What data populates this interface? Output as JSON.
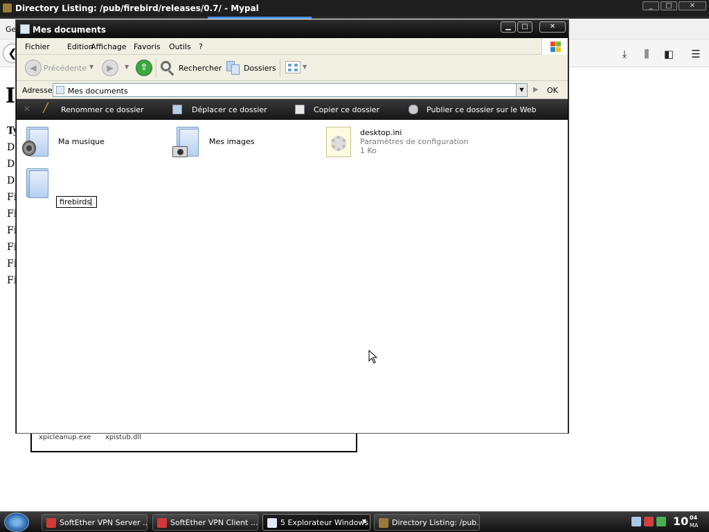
{
  "browser": {
    "title": "Directory Listing: /pub/firebird/releases/0.7/ - Mypal",
    "menu_fragment": "Ge",
    "page": {
      "heading_fragment": "I",
      "lines": [
        "Ty",
        "D",
        "D",
        "D",
        "Fi",
        "Fi",
        "Fi",
        "Fi",
        "Fi",
        "Fi"
      ],
      "box_files": [
        "xpicleanup.exe",
        "xpistub.dll"
      ]
    },
    "window_controls": [
      "_",
      "□",
      "✕"
    ],
    "toolbar_icons": [
      "download-icon",
      "library-icon",
      "sidebar-icon",
      "menu-icon"
    ]
  },
  "explorer": {
    "title": "Mes documents",
    "menu": [
      "Fichier",
      "Edition",
      "Affichage",
      "Favoris",
      "Outils",
      "?"
    ],
    "toolbar": {
      "back_label": "Précédente",
      "search_label": "Rechercher",
      "folders_label": "Dossiers"
    },
    "address": {
      "label": "Adresse",
      "value": "Mes documents",
      "go_label": "OK"
    },
    "tasks": [
      "Renommer ce dossier",
      "Déplacer ce dossier",
      "Copier ce dossier",
      "Publier ce dossier sur le Web"
    ],
    "items": [
      {
        "name": "Ma musique"
      },
      {
        "name": "Mes images"
      },
      {
        "name": "desktop.ini",
        "type": "Paramètres de configuration",
        "size": "1 Ko"
      }
    ],
    "rename_value": "firebirds"
  },
  "taskbar": {
    "buttons": [
      {
        "label": "SoftEther VPN Server ...",
        "color": "#d23a3a"
      },
      {
        "label": "SoftEther VPN Client ...",
        "color": "#d23a3a"
      },
      {
        "label": "5 Explorateur Windows",
        "color": "#dfe8f6"
      },
      {
        "label": "Directory Listing: /pub...",
        "color": "#9a7a3a"
      }
    ],
    "clock": {
      "time": "10",
      "minutes": "04",
      "ampm": "MA"
    }
  }
}
